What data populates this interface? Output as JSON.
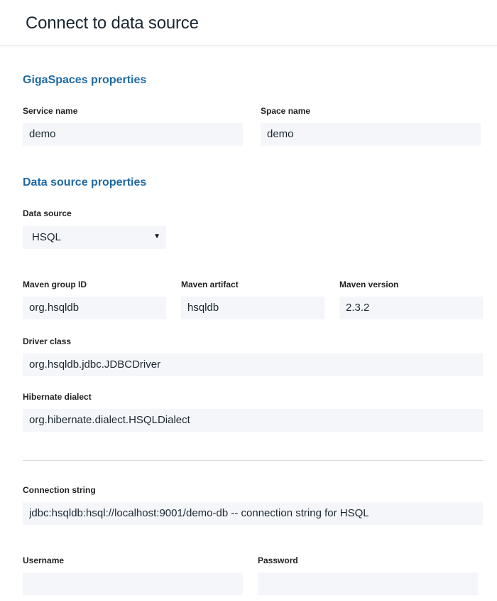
{
  "header": {
    "title": "Connect to data source"
  },
  "gigaspaces": {
    "title": "GigaSpaces properties",
    "service_name_label": "Service name",
    "service_name_value": "demo",
    "space_name_label": "Space name",
    "space_name_value": "demo"
  },
  "datasource": {
    "title": "Data source properties",
    "source_label": "Data source",
    "source_value": "HSQL",
    "group_id_label": "Maven group ID",
    "group_id_value": "org.hsqldb",
    "artifact_label": "Maven artifact",
    "artifact_value": "hsqldb",
    "version_label": "Maven version",
    "version_value": "2.3.2",
    "driver_label": "Driver class",
    "driver_value": "org.hsqldb.jdbc.JDBCDriver",
    "dialect_label": "Hibernate dialect",
    "dialect_value": "org.hibernate.dialect.HSQLDialect"
  },
  "connection": {
    "string_label": "Connection string",
    "string_value": "jdbc:hsqldb:hsql://localhost:9001/demo-db -- connection string for HSQL",
    "username_label": "Username",
    "username_value": "",
    "password_label": "Password",
    "password_value": ""
  }
}
